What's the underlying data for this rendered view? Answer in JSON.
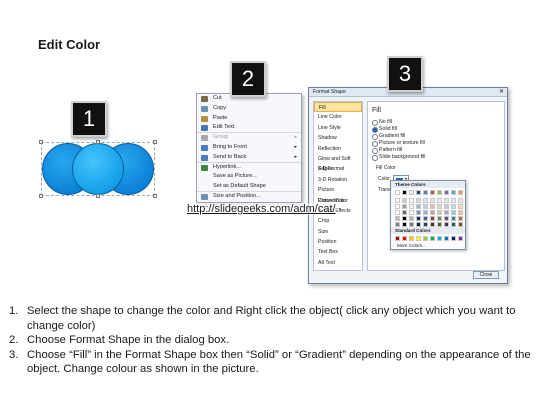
{
  "title": "Edit Color",
  "steps_badges": [
    "1",
    "2",
    "3"
  ],
  "context_menu": {
    "items": [
      {
        "label": "Cut",
        "icon": "scissors-icon",
        "color": "#7a6a4a"
      },
      {
        "label": "Copy",
        "icon": "copy-icon",
        "color": "#6c8fb8"
      },
      {
        "label": "Paste",
        "icon": "paste-icon",
        "color": "#b98b3b"
      },
      {
        "label": "Edit Text",
        "icon": "edit-text-icon",
        "color": "#4a76b0"
      },
      {
        "label": "Group",
        "icon": "group-icon",
        "color": "#a8a8a8",
        "disabled": true,
        "submenu": true
      },
      {
        "label": "Bring to Front",
        "icon": "bring-front-icon",
        "color": "#4b7bbf",
        "submenu": true
      },
      {
        "label": "Send to Back",
        "icon": "send-back-icon",
        "color": "#4b7bbf",
        "submenu": true
      },
      {
        "label": "Hyperlink...",
        "icon": "globe-link-icon",
        "color": "#3f8a3a"
      },
      {
        "label": "Save as Picture...",
        "icon": "",
        "color": ""
      },
      {
        "label": "Set as Default Shape",
        "icon": "",
        "color": ""
      },
      {
        "label": "Size and Position...",
        "icon": "size-position-icon",
        "color": "#6d8fb5"
      }
    ]
  },
  "dialog": {
    "title": "Format Shape",
    "nav": [
      "Fill",
      "Line Color",
      "Line Style",
      "Shadow",
      "Reflection",
      "Glow and Soft Edges",
      "3-D Format",
      "3-D Rotation",
      "Picture Corrections",
      "Picture Color",
      "Artistic Effects",
      "Crop",
      "Size",
      "Position",
      "Text Box",
      "Alt Text"
    ],
    "pane_title": "Fill",
    "options": [
      "No fill",
      "Solid fill",
      "Gradient fill",
      "Picture or texture fill",
      "Pattern fill",
      "Slide background fill"
    ],
    "fill_color_label": "Fill Color",
    "color_label": "Color:",
    "transparency_label": "Transpar",
    "close": "Close"
  },
  "palette": {
    "theme_header": "Theme Colors",
    "standard_header": "Standard Colors",
    "more": "More Colors...",
    "theme_top": [
      "#ffffff",
      "#000000",
      "#eeece1",
      "#1f497d",
      "#4f81bd",
      "#c0504d",
      "#9bbb59",
      "#8064a2",
      "#4bacc6",
      "#f79646"
    ],
    "standard": [
      "#c00000",
      "#ff0000",
      "#ffc000",
      "#ffff00",
      "#92d050",
      "#00b050",
      "#00b0f0",
      "#0070c0",
      "#002060",
      "#7030a0"
    ]
  },
  "link": "http://slidegeeks.com/adm/cat/",
  "instructions": [
    {
      "num": "1.",
      "text": "Select the shape to change the color and Right click the object( click any object which you want to change color)"
    },
    {
      "num": "2.",
      "text": "Choose Format Shape in the dialog box."
    },
    {
      "num": "3.",
      "text": "Choose “Fill” in the Format Shape box then “Solid” or “Gradient” depending on the appearance of the object. Change colour as shown in the picture."
    }
  ]
}
